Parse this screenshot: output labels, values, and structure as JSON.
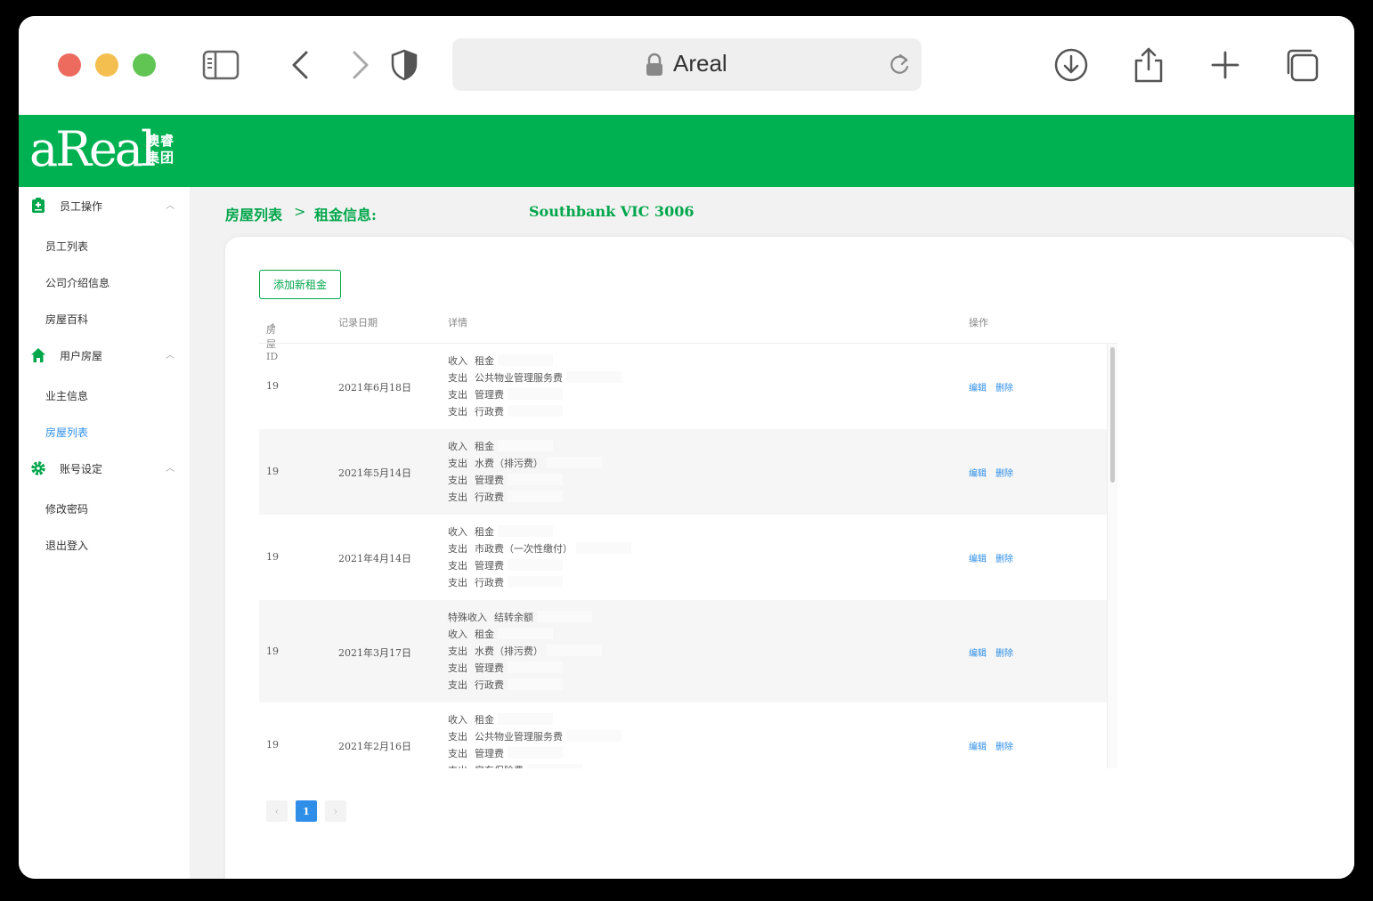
{
  "browser": {
    "address_title": "Areal"
  },
  "header": {
    "logo_text": "aReal",
    "logo_cn_line1": "澳睿",
    "logo_cn_line2": "集团"
  },
  "sidebar": {
    "groups": [
      {
        "label": "员工操作",
        "items": [
          "员工列表",
          "公司介绍信息",
          "房屋百科"
        ]
      },
      {
        "label": "用户房屋",
        "items": [
          "业主信息",
          "房屋列表"
        ]
      },
      {
        "label": "账号设定",
        "items": [
          "修改密码",
          "退出登入"
        ]
      }
    ],
    "active_item": "房屋列表"
  },
  "breadcrumb": {
    "root": "房屋列表",
    "separator": ">",
    "current": "租金信息:",
    "address": "Southbank VIC 3006"
  },
  "toolbar": {
    "add_label": "添加新租金"
  },
  "table": {
    "headers": {
      "id": "房屋ID",
      "date": "记录日期",
      "detail": "详情",
      "ops": "操作"
    },
    "sort_glyph": "⬍",
    "op_edit": "编辑",
    "op_delete": "删除",
    "rows": [
      {
        "id": "19",
        "date": "2021年6月18日",
        "details": [
          {
            "kind": "收入",
            "item": "租金"
          },
          {
            "kind": "支出",
            "item": "公共物业管理服务费"
          },
          {
            "kind": "支出",
            "item": "管理费"
          },
          {
            "kind": "支出",
            "item": "行政费"
          }
        ]
      },
      {
        "id": "19",
        "date": "2021年5月14日",
        "details": [
          {
            "kind": "收入",
            "item": "租金"
          },
          {
            "kind": "支出",
            "item": "水费（排污费）"
          },
          {
            "kind": "支出",
            "item": "管理费"
          },
          {
            "kind": "支出",
            "item": "行政费"
          }
        ]
      },
      {
        "id": "19",
        "date": "2021年4月14日",
        "details": [
          {
            "kind": "收入",
            "item": "租金"
          },
          {
            "kind": "支出",
            "item": "市政费（一次性缴付）"
          },
          {
            "kind": "支出",
            "item": "管理费"
          },
          {
            "kind": "支出",
            "item": "行政费"
          }
        ]
      },
      {
        "id": "19",
        "date": "2021年3月17日",
        "details": [
          {
            "kind": "特殊收入",
            "item": "结转余额"
          },
          {
            "kind": "收入",
            "item": "租金"
          },
          {
            "kind": "支出",
            "item": "水费（排污费）"
          },
          {
            "kind": "支出",
            "item": "管理费"
          },
          {
            "kind": "支出",
            "item": "行政费"
          }
        ]
      },
      {
        "id": "19",
        "date": "2021年2月16日",
        "details": [
          {
            "kind": "收入",
            "item": "租金"
          },
          {
            "kind": "支出",
            "item": "公共物业管理服务费"
          },
          {
            "kind": "支出",
            "item": "管理费"
          },
          {
            "kind": "支出",
            "item": "房东保险费"
          }
        ]
      }
    ]
  },
  "pagination": {
    "prev": "‹",
    "current": "1",
    "next": "›"
  },
  "colors": {
    "brand_green": "#00b152",
    "link_blue": "#2f8fe8"
  }
}
